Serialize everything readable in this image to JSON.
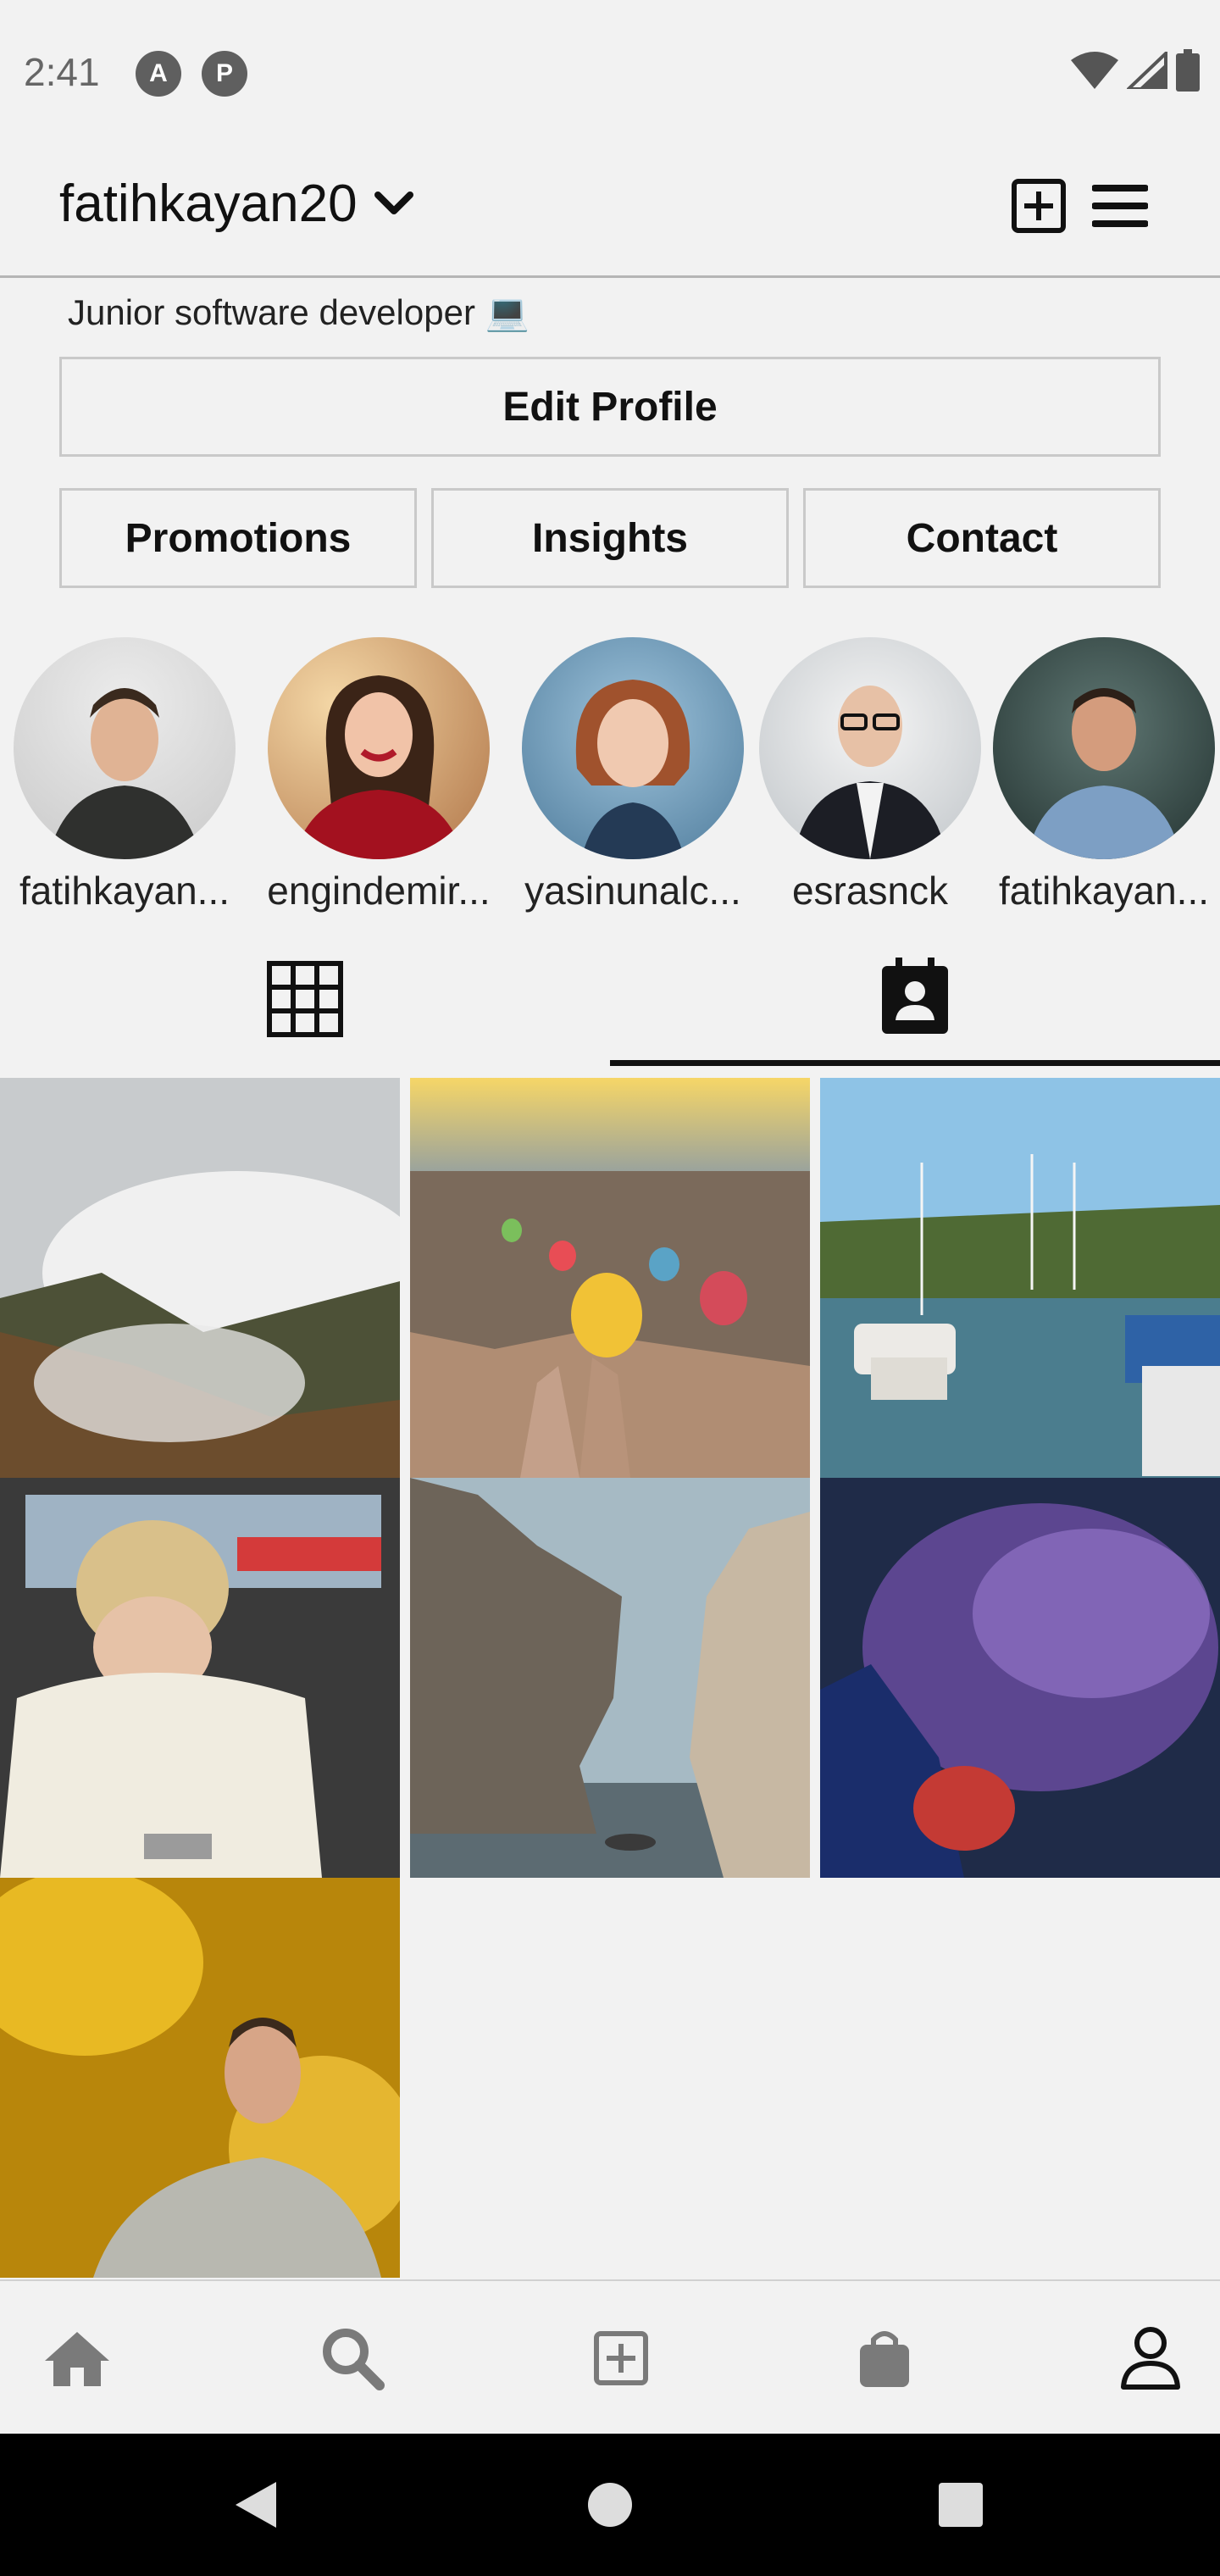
{
  "status_bar": {
    "time": "2:41",
    "app_icons": [
      "A",
      "P"
    ]
  },
  "header": {
    "username": "fatihkayan20"
  },
  "profile": {
    "bio": "Junior software developer 💻",
    "edit_profile_label": "Edit Profile",
    "actions": [
      "Promotions",
      "Insights",
      "Contact"
    ]
  },
  "stories": [
    {
      "name": "fatihkayan..."
    },
    {
      "name": "engindemir..."
    },
    {
      "name": "yasinunalc..."
    },
    {
      "name": "esrasnck"
    },
    {
      "name": "fatihkayan..."
    }
  ],
  "tabs": [
    {
      "icon": "grid-icon",
      "active": false
    },
    {
      "icon": "tagged-contact-icon",
      "active": true
    }
  ],
  "posts": [
    {
      "subject": "misty mountain"
    },
    {
      "subject": "hot air balloons"
    },
    {
      "subject": "harbor boats"
    },
    {
      "subject": "woman in car"
    },
    {
      "subject": "sea rock"
    },
    {
      "subject": "purple smoke"
    },
    {
      "subject": "man in autumn"
    }
  ],
  "bottom_nav": [
    "home-icon",
    "search-icon",
    "add-post-icon",
    "shop-icon",
    "profile-icon"
  ],
  "colors": {
    "background": "#f2f2f2",
    "text": "#111111",
    "border": "#c9c9c9"
  }
}
